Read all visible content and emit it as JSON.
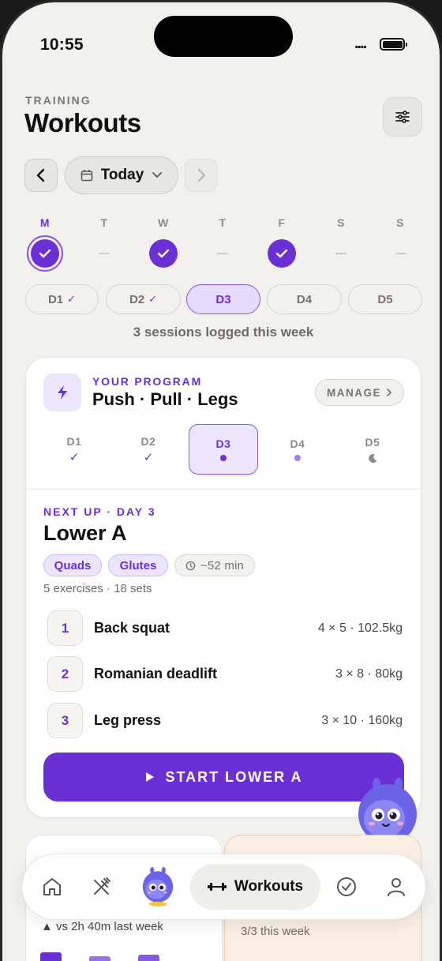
{
  "status_bar": {
    "time": "10:55",
    "signal": "...."
  },
  "header": {
    "eyebrow": "TRAINING",
    "title": "Workouts"
  },
  "date_nav": {
    "label": "Today"
  },
  "week": {
    "days": [
      {
        "letter": "M",
        "state": "done-today"
      },
      {
        "letter": "T",
        "state": "rest"
      },
      {
        "letter": "W",
        "state": "done"
      },
      {
        "letter": "T",
        "state": "rest"
      },
      {
        "letter": "F",
        "state": "done"
      },
      {
        "letter": "S",
        "state": "rest"
      },
      {
        "letter": "S",
        "state": "rest"
      }
    ],
    "chips": [
      {
        "label": "D1",
        "check": "✓",
        "active": false
      },
      {
        "label": "D2",
        "check": "✓",
        "active": false
      },
      {
        "label": "D3",
        "check": "",
        "active": true
      },
      {
        "label": "D4",
        "check": "",
        "active": false
      },
      {
        "label": "D5",
        "check": "",
        "active": false
      }
    ],
    "summary": "3 sessions logged this week"
  },
  "program": {
    "eyebrow": "YOUR PROGRAM",
    "name": "Push · Pull · Legs",
    "manage_label": "MANAGE",
    "days": [
      {
        "label": "D1",
        "state": "done"
      },
      {
        "label": "D2",
        "state": "done"
      },
      {
        "label": "D3",
        "state": "current"
      },
      {
        "label": "D4",
        "state": "upcoming"
      },
      {
        "label": "D5",
        "state": "rest"
      }
    ],
    "next": {
      "eyebrow": "NEXT UP · DAY 3",
      "title": "Lower A",
      "tags": [
        "Quads",
        "Glutes"
      ],
      "duration": "~52 min",
      "meta": "5 exercises · 18 sets",
      "exercises": [
        {
          "num": "1",
          "name": "Back squat",
          "spec": "4 × 5 · 102.5kg"
        },
        {
          "num": "2",
          "name": "Romanian deadlift",
          "spec": "3 × 8 · 80kg"
        },
        {
          "num": "3",
          "name": "Leg press",
          "spec": "3 × 10 · 160kg"
        }
      ],
      "start_label": "START LOWER A"
    }
  },
  "stats": {
    "volume_compare": "▲ vs 2h 40m last week",
    "sessions_week": "3/3 this week"
  },
  "tabbar": {
    "active_label": "Workouts",
    "icons": [
      "home-icon",
      "fork-knife-icon",
      "mascot-icon",
      "dumbbell-icon",
      "check-circle-icon",
      "profile-icon"
    ]
  },
  "colors": {
    "accent": "#6b2fd6",
    "accent_soft": "#ece5fb",
    "background": "#f2f1ee"
  }
}
